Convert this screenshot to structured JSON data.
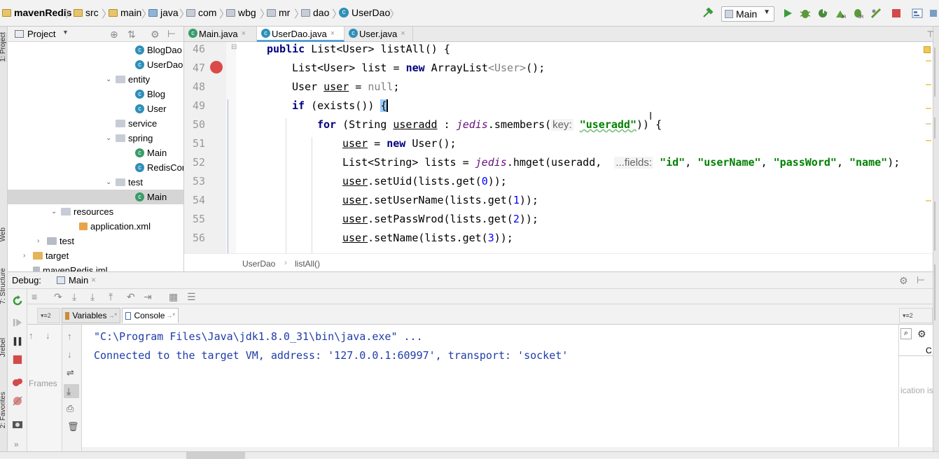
{
  "navbar": {
    "crumbs": [
      "mavenRedis",
      "src",
      "main",
      "java",
      "com",
      "wbg",
      "mr",
      "dao",
      "UserDao"
    ],
    "run_config": "Main"
  },
  "side_strip": {
    "labels": [
      "1: Project",
      "Web",
      "7: Structure",
      "Jrebel",
      "2: Favorites"
    ]
  },
  "project": {
    "title": "Project",
    "tree": [
      {
        "label": "BlogDao",
        "type": "class"
      },
      {
        "label": "UserDao",
        "type": "class"
      },
      {
        "label": "entity",
        "type": "package"
      },
      {
        "label": "Blog",
        "type": "class"
      },
      {
        "label": "User",
        "type": "class"
      },
      {
        "label": "service",
        "type": "package"
      },
      {
        "label": "spring",
        "type": "package"
      },
      {
        "label": "Main",
        "type": "main"
      },
      {
        "label": "RedisCor",
        "type": "class"
      },
      {
        "label": "test",
        "type": "package"
      },
      {
        "label": "Main",
        "type": "main"
      },
      {
        "label": "resources",
        "type": "folder"
      },
      {
        "label": "application.xml",
        "type": "xml"
      },
      {
        "label": "test",
        "type": "folder"
      },
      {
        "label": "target",
        "type": "folder"
      },
      {
        "label": "mavenRedis.iml",
        "type": "file"
      }
    ]
  },
  "tabs": [
    {
      "label": "Main.java"
    },
    {
      "label": "UserDao.java"
    },
    {
      "label": "User.java"
    }
  ],
  "editor": {
    "line_numbers": [
      "46",
      "47",
      "48",
      "49",
      "50",
      "51",
      "52",
      "53",
      "54",
      "55",
      "56"
    ],
    "code": {
      "l46": {
        "kw": "public",
        "rest": " List<User> listAll() {"
      },
      "l47": {
        "a": "List<User> list = ",
        "kw": "new",
        "b": " ArrayList",
        "c": "<User>",
        "d": "();"
      },
      "l48": {
        "a": "User ",
        "var": "user",
        "b": " = ",
        "null": "null",
        "c": ";"
      },
      "l49": {
        "kw": "if",
        "rest": " (exists()) ",
        "brace": "{"
      },
      "l50": {
        "kw": "for",
        "a": " (String ",
        "var": "useradd",
        "b": " : ",
        "fd": "jedis",
        "c": ".smembers(",
        "hint": "key:",
        "str": "\"useradd\"",
        "d": ")) {"
      },
      "l51": {
        "var": "user",
        "a": " = ",
        "kw": "new",
        "b": " User();"
      },
      "l52": {
        "a": "List<String> lists = ",
        "fd": "jedis",
        "b": ".hmget(useradd,  ",
        "hint": "...fields:",
        "s1": "\"id\"",
        "s2": "\"userName\"",
        "s3": "\"passWord\"",
        "s4": "\"name\"",
        "c": ");"
      },
      "l53": {
        "var": "user",
        "a": ".setUid(lists.get(",
        "n": "0",
        "b": "));"
      },
      "l54": {
        "var": "user",
        "a": ".setUserName(lists.get(",
        "n": "1",
        "b": "));"
      },
      "l55": {
        "var": "user",
        "a": ".setPassWrod(lists.get(",
        "n": "2",
        "b": "));"
      },
      "l56": {
        "var": "user",
        "a": ".setName(lists.get(",
        "n": "3",
        "b": "));"
      }
    },
    "breadcrumb": [
      "UserDao",
      "listAll()"
    ]
  },
  "debug": {
    "title": "Debug:",
    "config": "Main",
    "subtabs": [
      {
        "label": "Variables"
      },
      {
        "label": "Console"
      }
    ],
    "frames_label": "Frames",
    "console_lines": [
      "\"C:\\Program Files\\Java\\jdk1.8.0_31\\bin\\java.exe\" ...",
      "Connected to the target VM, address: '127.0.0.1:60997', transport: 'socket'"
    ],
    "right_panel_text": "ication is"
  },
  "colors": {
    "accent": "#2f8fb8",
    "breakpoint": "#db4a4a",
    "console_text": "#1f3da8",
    "keyword": "#000080",
    "string": "#008000"
  }
}
